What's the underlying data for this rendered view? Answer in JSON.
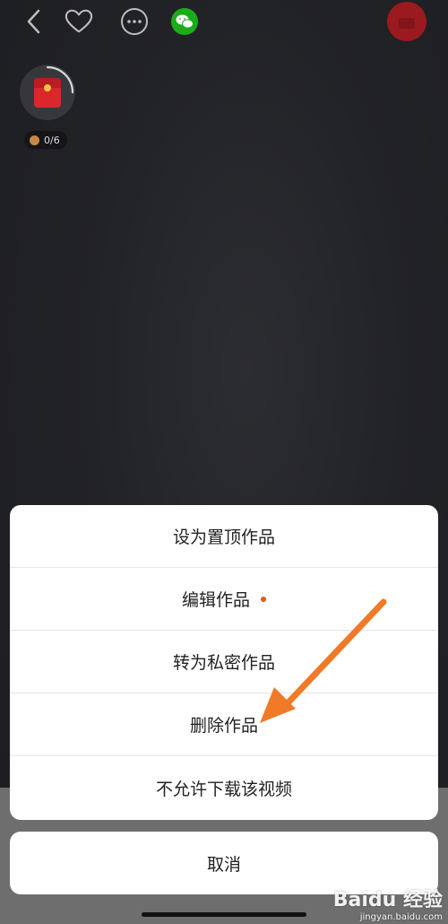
{
  "progress": {
    "text": "0/6"
  },
  "action_sheet": {
    "items": [
      {
        "label": "设为置顶作品"
      },
      {
        "label": "编辑作品",
        "has_dot": true
      },
      {
        "label": "转为私密作品"
      },
      {
        "label": "删除作品"
      },
      {
        "label": "不允许下载该视频"
      }
    ],
    "cancel_label": "取消"
  },
  "watermark": {
    "logo": "Baidu 经验",
    "url": "jingyan.baidu.com"
  },
  "colors": {
    "accent_dot": "#e8551e",
    "arrow": "#f07a28",
    "wechat": "#1aad19",
    "red_packet": "#d9272c"
  },
  "icons": [
    "back-icon",
    "heart-icon",
    "more-icon",
    "wechat-icon",
    "red-packet-icon",
    "coin-icon"
  ]
}
